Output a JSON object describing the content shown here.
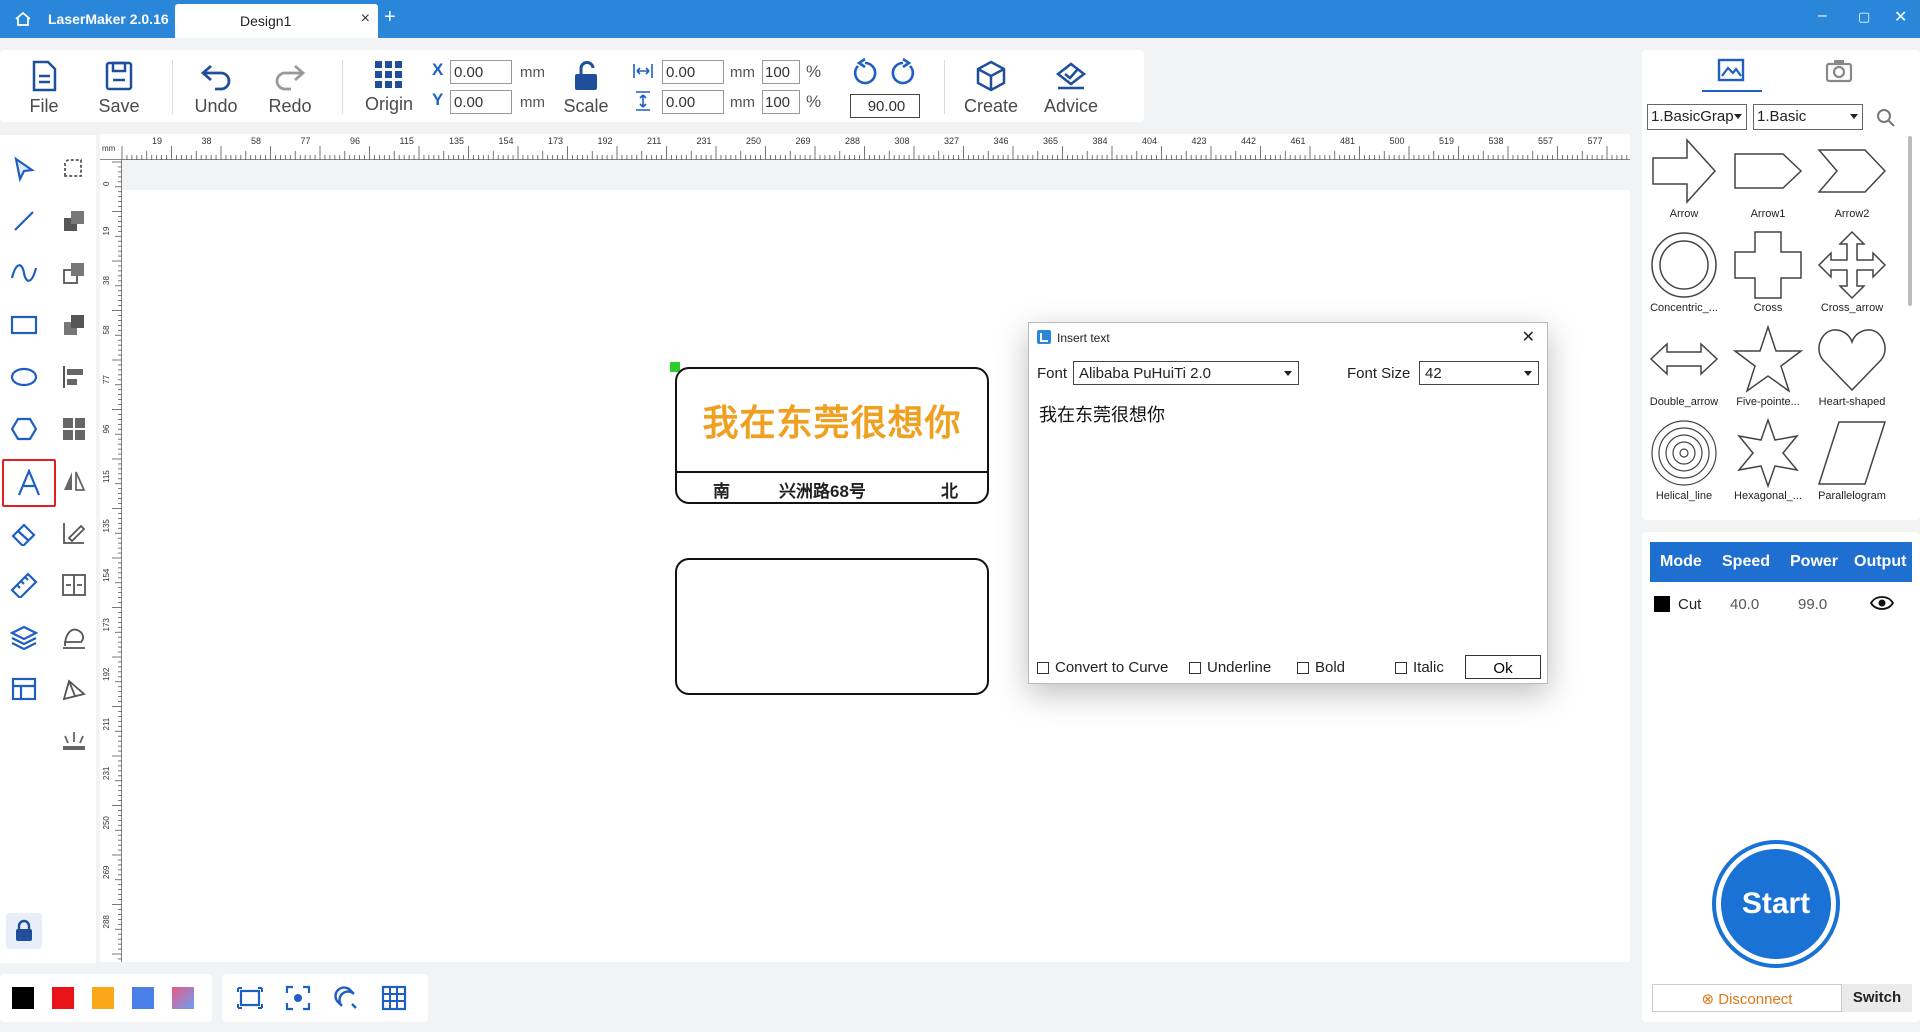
{
  "titlebar": {
    "app_name": "LaserMaker 2.0.16",
    "tab_label": "Design1",
    "tab_close": "×",
    "new_tab": "+",
    "minimize": "–",
    "restore": "▢",
    "close": "✕"
  },
  "toolbar": {
    "file": "File",
    "save": "Save",
    "undo": "Undo",
    "redo": "Redo",
    "origin": "Origin",
    "x_label": "X",
    "x_value": "0.00",
    "y_label": "Y",
    "y_value": "0.00",
    "unit_mm": "mm",
    "scale": "Scale",
    "width_value": "0.00",
    "height_value": "0.00",
    "width_pct": "100",
    "height_pct": "100",
    "pct_sign": "%",
    "rotation_value": "90.00",
    "create": "Create",
    "advice": "Advice"
  },
  "ruler": {
    "unit": "mm",
    "top_labels": [
      "19",
      "38",
      "58",
      "77",
      "96",
      "115",
      "135",
      "154",
      "173",
      "192",
      "211",
      "231",
      "250",
      "269",
      "288",
      "308",
      "327",
      "346",
      "365",
      "384",
      "404",
      "423",
      "442",
      "461",
      "481",
      "500",
      "519",
      "538",
      "557",
      "577"
    ],
    "left_labels": [
      "0",
      "19",
      "38",
      "58",
      "77",
      "96",
      "115",
      "135",
      "154",
      "173",
      "192",
      "211",
      "231",
      "250",
      "269",
      "288"
    ]
  },
  "canvas": {
    "box1_text": "我在东莞很想你",
    "box1_bottom_left": "南",
    "box1_bottom_mid": "兴洲路68号",
    "box1_bottom_right": "北"
  },
  "right_panel": {
    "category_select": "1.BasicGrap",
    "subcategory_select": "1.Basic",
    "shapes": [
      "Arrow",
      "Arrow1",
      "Arrow2",
      "Concentric_...",
      "Cross",
      "Cross_arrow",
      "Double_arrow",
      "Five-pointe...",
      "Heart-shaped",
      "Helical_line",
      "Hexagonal_...",
      "Parallelogram"
    ]
  },
  "layers": {
    "headers": [
      "Mode",
      "Speed",
      "Power",
      "Output"
    ],
    "row": {
      "mode": "Cut",
      "speed": "40.0",
      "power": "99.0",
      "color": "#000000"
    }
  },
  "start_label": "Start",
  "disconnect_label": "Disconnect",
  "switch_label": "Switch",
  "dialog": {
    "title": "Insert text",
    "font_label": "Font",
    "font_value": "Alibaba PuHuiTi 2.0",
    "font_size_label": "Font Size",
    "font_size_value": "42",
    "text_content": "我在东莞很想你",
    "convert_to_curve": "Convert to Curve",
    "underline": "Underline",
    "bold": "Bold",
    "italic": "Italic",
    "ok": "Ok"
  },
  "colors": {
    "accent": "#2a86d8",
    "swatches": [
      "#000000",
      "#e8141a",
      "#f8a818",
      "#4a7fe8",
      "#e070a0"
    ]
  }
}
